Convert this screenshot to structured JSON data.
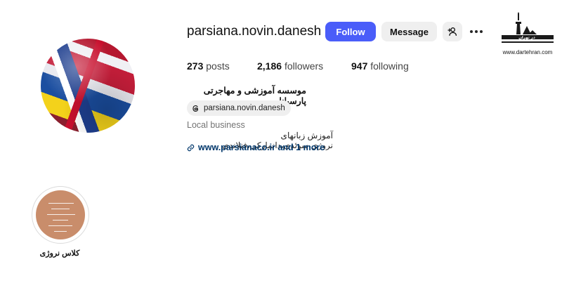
{
  "profile": {
    "username": "parsiana.novin.danesh",
    "posts_count": "273",
    "posts_label": "posts",
    "followers_count": "2,186",
    "followers_label": "followers",
    "following_count": "947",
    "following_label": "following",
    "full_name": "موسسه آموزشی و مهاجرتی پارسیانا",
    "threads_handle": "parsiana.novin.danesh",
    "category": "Local business",
    "bio": "آموزش زبانهای نروژی،سوئدی،دانمارکی،فنلاندی",
    "link_text": "www.parsianaco.ir and 1 more"
  },
  "actions": {
    "follow_label": "Follow",
    "message_label": "Message"
  },
  "highlights": [
    {
      "label": "کلاس نروژی"
    }
  ],
  "watermark": {
    "site": "www.dartehran.com",
    "brand": "در تهران"
  },
  "icons": {
    "add_user": "person-plus-icon",
    "more": "more-horizontal-icon",
    "threads": "threads-icon",
    "link": "link-icon"
  },
  "colors": {
    "follow_button": "#4a5df9",
    "secondary_button": "#efefef",
    "link": "#00376b",
    "highlight_fill": "#c98d6b"
  }
}
